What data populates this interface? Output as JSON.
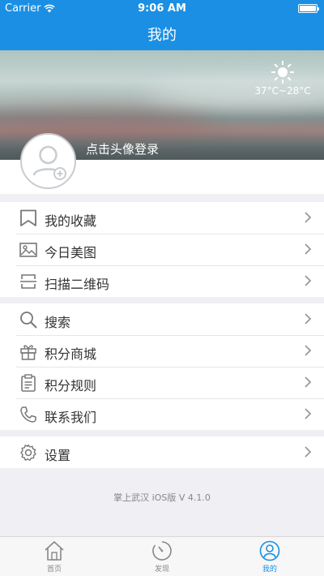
{
  "status_bar": {
    "carrier": "Carrier",
    "time": "9:06 AM"
  },
  "nav": {
    "title": "我的"
  },
  "weather": {
    "icon": "sun-icon",
    "temperature": "37°C~28°C"
  },
  "profile": {
    "login_prompt": "点击头像登录",
    "avatar_icon": "avatar-placeholder-icon"
  },
  "menu_group_1": [
    {
      "label": "我的收藏",
      "icon": "bookmark-icon"
    },
    {
      "label": "今日美图",
      "icon": "image-icon"
    },
    {
      "label": "扫描二维码",
      "icon": "scan-icon"
    }
  ],
  "menu_group_2": [
    {
      "label": "搜索",
      "icon": "search-icon"
    },
    {
      "label": "积分商城",
      "icon": "gift-icon"
    },
    {
      "label": "积分规则",
      "icon": "clipboard-icon"
    },
    {
      "label": "联系我们",
      "icon": "phone-icon"
    }
  ],
  "menu_group_3": [
    {
      "label": "设置",
      "icon": "gear-icon"
    }
  ],
  "footer": {
    "version": "掌上武汉 iOS版 V 4.1.0"
  },
  "tabs": [
    {
      "label": "首页",
      "icon": "home-icon",
      "active": false
    },
    {
      "label": "发现",
      "icon": "clock-icon",
      "active": false
    },
    {
      "label": "我的",
      "icon": "user-icon",
      "active": true
    }
  ],
  "colors": {
    "accent": "#1a8fe3",
    "background": "#efeff4"
  }
}
